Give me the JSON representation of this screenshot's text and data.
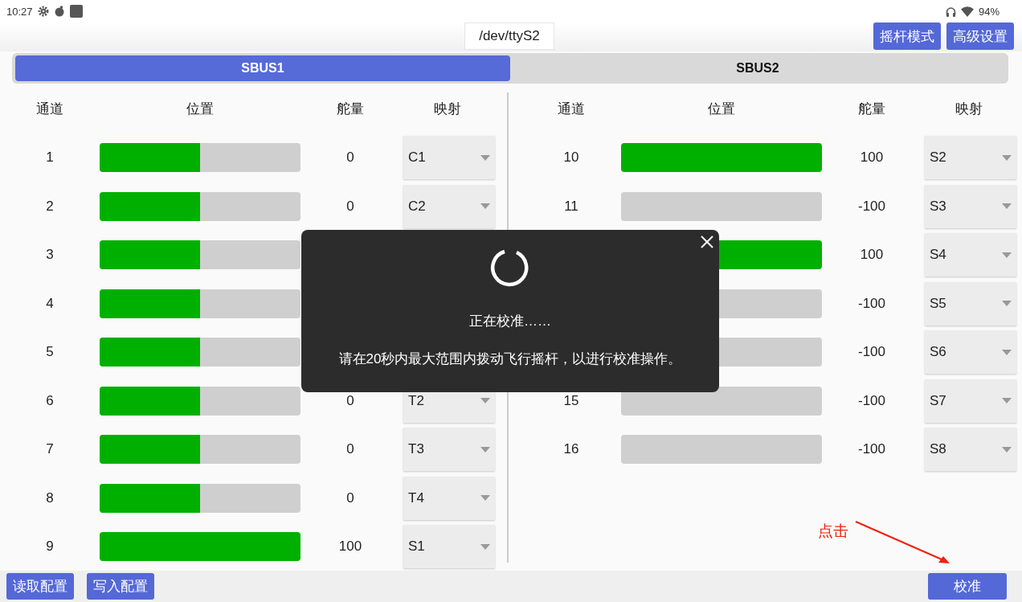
{
  "status_bar": {
    "time": "10:27",
    "battery": "94%"
  },
  "port": {
    "value": "/dev/ttyS2"
  },
  "header_buttons": [
    "摇杆模式",
    "高级设置"
  ],
  "tabs": [
    {
      "label": "SBUS1",
      "selected": true
    },
    {
      "label": "SBUS2",
      "selected": false
    }
  ],
  "panels": [
    {
      "columns": [
        "通道",
        "位置",
        "舵量",
        "映射"
      ],
      "rows": [
        {
          "channel": "1",
          "level": 0.5,
          "amount": "0",
          "mapping": "C1"
        },
        {
          "channel": "2",
          "level": 0.5,
          "amount": "0",
          "mapping": "C2"
        },
        {
          "channel": "3",
          "level": 0.5
        },
        {
          "channel": "4",
          "level": 0.5
        },
        {
          "channel": "5",
          "level": 0.5
        },
        {
          "channel": "6",
          "level": 0.5,
          "amount": "0",
          "mapping": "T2"
        },
        {
          "channel": "7",
          "level": 0.5,
          "amount": "0",
          "mapping": "T3"
        },
        {
          "channel": "8",
          "level": 0.5,
          "amount": "0",
          "mapping": "T4"
        },
        {
          "channel": "9",
          "level": 1,
          "amount": "100",
          "mapping": "S1"
        }
      ]
    },
    {
      "columns": [
        "通道",
        "位置",
        "舵量",
        "映射"
      ],
      "rows": [
        {
          "channel": "10",
          "level": 1,
          "amount": "100",
          "mapping": "S2"
        },
        {
          "channel": "11",
          "level": 0,
          "amount": "-100",
          "mapping": "S3"
        },
        {
          "level": 1,
          "amount": "100",
          "mapping": "S4"
        },
        {
          "level": 0,
          "amount": "-100",
          "mapping": "S5"
        },
        {
          "level": 0,
          "amount": "-100",
          "mapping": "S6"
        },
        {
          "channel": "15",
          "level": 0,
          "amount": "-100",
          "mapping": "S7"
        },
        {
          "channel": "16",
          "level": 0,
          "amount": "-100",
          "mapping": "S8"
        }
      ]
    }
  ],
  "dialog": {
    "title": "正在校准……",
    "message": "请在20秒内最大范围内拨动飞行摇杆，以进行校准操作。"
  },
  "annotation": {
    "text": "点击"
  },
  "bottom_buttons": [
    "读取配置",
    "写入配置"
  ],
  "calibrate_button": "校准"
}
